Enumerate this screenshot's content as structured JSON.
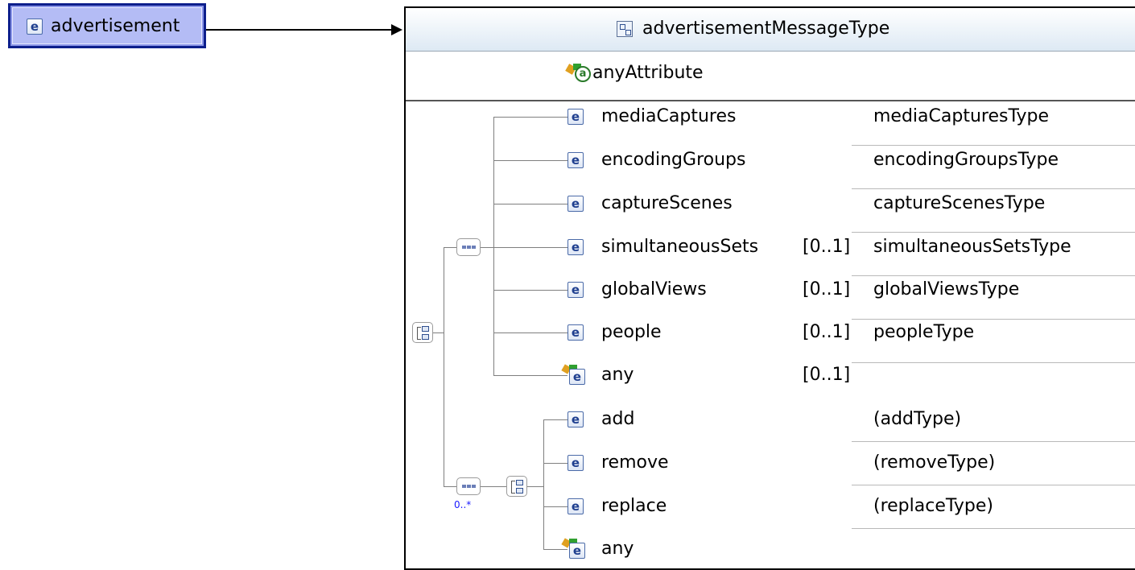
{
  "root": {
    "icon": "element-icon",
    "icon_letter": "e",
    "label": "advertisement"
  },
  "type_panel": {
    "title": "advertisementMessageType",
    "title_icon": "complex-type-icon",
    "attribute": {
      "icon": "any-attribute-icon",
      "label": "anyAttribute"
    }
  },
  "sequence_elements": [
    {
      "name": "mediaCaptures",
      "card": "",
      "type": "mediaCapturesType",
      "icon": "element-icon"
    },
    {
      "name": "encodingGroups",
      "card": "",
      "type": "encodingGroupsType",
      "icon": "element-icon"
    },
    {
      "name": "captureScenes",
      "card": "",
      "type": "captureScenesType",
      "icon": "element-icon"
    },
    {
      "name": "simultaneousSets",
      "card": "[0..1]",
      "type": "simultaneousSetsType",
      "icon": "element-icon"
    },
    {
      "name": "globalViews",
      "card": "[0..1]",
      "type": "globalViewsType",
      "icon": "element-icon"
    },
    {
      "name": "people",
      "card": "[0..1]",
      "type": "peopleType",
      "icon": "element-icon"
    },
    {
      "name": "any",
      "card": "[0..1]",
      "type": "",
      "icon": "any-element-icon"
    }
  ],
  "choice_elements": [
    {
      "name": "add",
      "card": "",
      "type": "(addType)",
      "icon": "element-icon"
    },
    {
      "name": "remove",
      "card": "",
      "type": "(removeType)",
      "icon": "element-icon"
    },
    {
      "name": "replace",
      "card": "",
      "type": "(replaceType)",
      "icon": "element-icon"
    },
    {
      "name": "any",
      "card": "",
      "type": "",
      "icon": "any-element-icon"
    }
  ],
  "occurrence_label": "0..*",
  "colors": {
    "root_border": "#0d1f8c",
    "root_fill": "#b4bcf5",
    "occurrence": "#1a1aff"
  }
}
